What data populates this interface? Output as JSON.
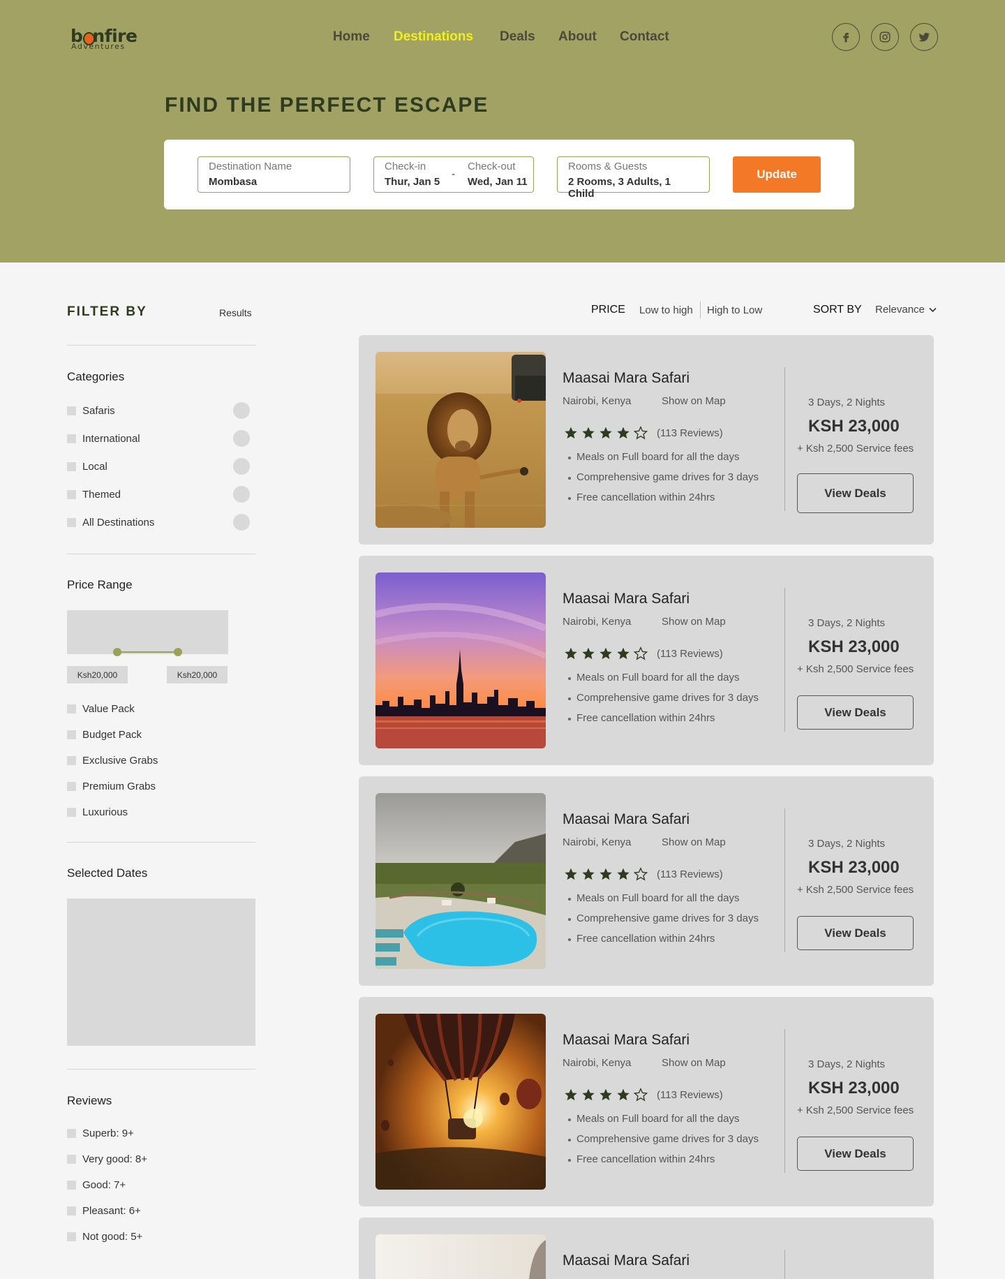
{
  "brand": {
    "name_start": "b",
    "name_end": "nfire",
    "tagline": "Adventures"
  },
  "nav": {
    "items": [
      {
        "label": "Home",
        "active": false
      },
      {
        "label": "Destinations",
        "active": true
      },
      {
        "label": "Deals",
        "active": false
      },
      {
        "label": "About",
        "active": false
      },
      {
        "label": "Contact",
        "active": false
      }
    ]
  },
  "social": [
    "facebook-icon",
    "instagram-icon",
    "twitter-icon"
  ],
  "hero": {
    "title": "FIND THE PERFECT ESCAPE"
  },
  "search": {
    "destination_label": "Destination Name",
    "destination_value": "Mombasa",
    "checkin_label": "Check-in",
    "checkin_value": "Thur, Jan 5",
    "dash": "-",
    "checkout_label": "Check-out",
    "checkout_value": "Wed, Jan 11",
    "guests_label": "Rooms & Guests",
    "guests_value": "2 Rooms, 3 Adults, 1 Child",
    "update_label": "Update"
  },
  "colors": {
    "header_bg": "#a1a264",
    "accent": "#f47926",
    "active_nav": "#f1f01e",
    "dark_green": "#2f3b1f"
  },
  "filter": {
    "title": "FILTER BY",
    "results_label": "Results",
    "categories_title": "Categories",
    "categories": [
      "Safaris",
      "International",
      "Local",
      "Themed",
      "All Destinations"
    ],
    "price_title": "Price Range",
    "price_min": "Ksh20,000",
    "price_max": "Ksh20,000",
    "packs": [
      "Value Pack",
      "Budget Pack",
      "Exclusive Grabs",
      "Premium Grabs",
      "Luxurious"
    ],
    "dates_title": "Selected Dates",
    "reviews_title": "Reviews",
    "reviews": [
      "Superb: 9+",
      "Very good: 8+",
      "Good: 7+",
      "Pleasant: 6+",
      "Not good: 5+"
    ]
  },
  "sort": {
    "price_label": "PRICE",
    "low_high": "Low to high",
    "high_low": "High to Low",
    "sortby_label": "SORT BY",
    "sortby_value": "Relevance"
  },
  "listings": [
    {
      "image": "lion",
      "title": "Maasai Mara Safari",
      "location": "Nairobi, Kenya",
      "map_label": "Show on Map",
      "rating": 4,
      "reviews": "(113 Reviews)",
      "features": [
        "Meals on Full board for all the days",
        "Comprehensive game drives for 3 days",
        "Free cancellation within 24hrs"
      ],
      "duration": "3 Days, 2 Nights",
      "price": "KSH 23,000",
      "fees": "+ Ksh 2,500 Service fees",
      "cta": "View Deals"
    },
    {
      "image": "city-sunset",
      "title": "Maasai Mara Safari",
      "location": "Nairobi, Kenya",
      "map_label": "Show on Map",
      "rating": 4,
      "reviews": "(113 Reviews)",
      "features": [
        "Meals on Full board for all the days",
        "Comprehensive game drives for 3 days",
        "Free cancellation within 24hrs"
      ],
      "duration": "3 Days, 2 Nights",
      "price": "KSH 23,000",
      "fees": "+ Ksh 2,500 Service fees",
      "cta": "View Deals"
    },
    {
      "image": "pool-savanna",
      "title": "Maasai Mara Safari",
      "location": "Nairobi, Kenya",
      "map_label": "Show on Map",
      "rating": 4,
      "reviews": "(113 Reviews)",
      "features": [
        "Meals on Full board for all the days",
        "Comprehensive game drives for 3 days",
        "Free cancellation within 24hrs"
      ],
      "duration": "3 Days, 2 Nights",
      "price": "KSH 23,000",
      "fees": "+ Ksh 2,500 Service fees",
      "cta": "View Deals"
    },
    {
      "image": "balloon",
      "title": "Maasai Mara Safari",
      "location": "Nairobi, Kenya",
      "map_label": "Show on Map",
      "rating": 4,
      "reviews": "(113 Reviews)",
      "features": [
        "Meals on Full board for all the days",
        "Comprehensive game drives for 3 days",
        "Free cancellation within 24hrs"
      ],
      "duration": "3 Days, 2 Nights",
      "price": "KSH 23,000",
      "fees": "+ Ksh 2,500 Service fees",
      "cta": "View Deals"
    },
    {
      "image": "hazy-landscape",
      "title": "Maasai Mara Safari"
    }
  ]
}
